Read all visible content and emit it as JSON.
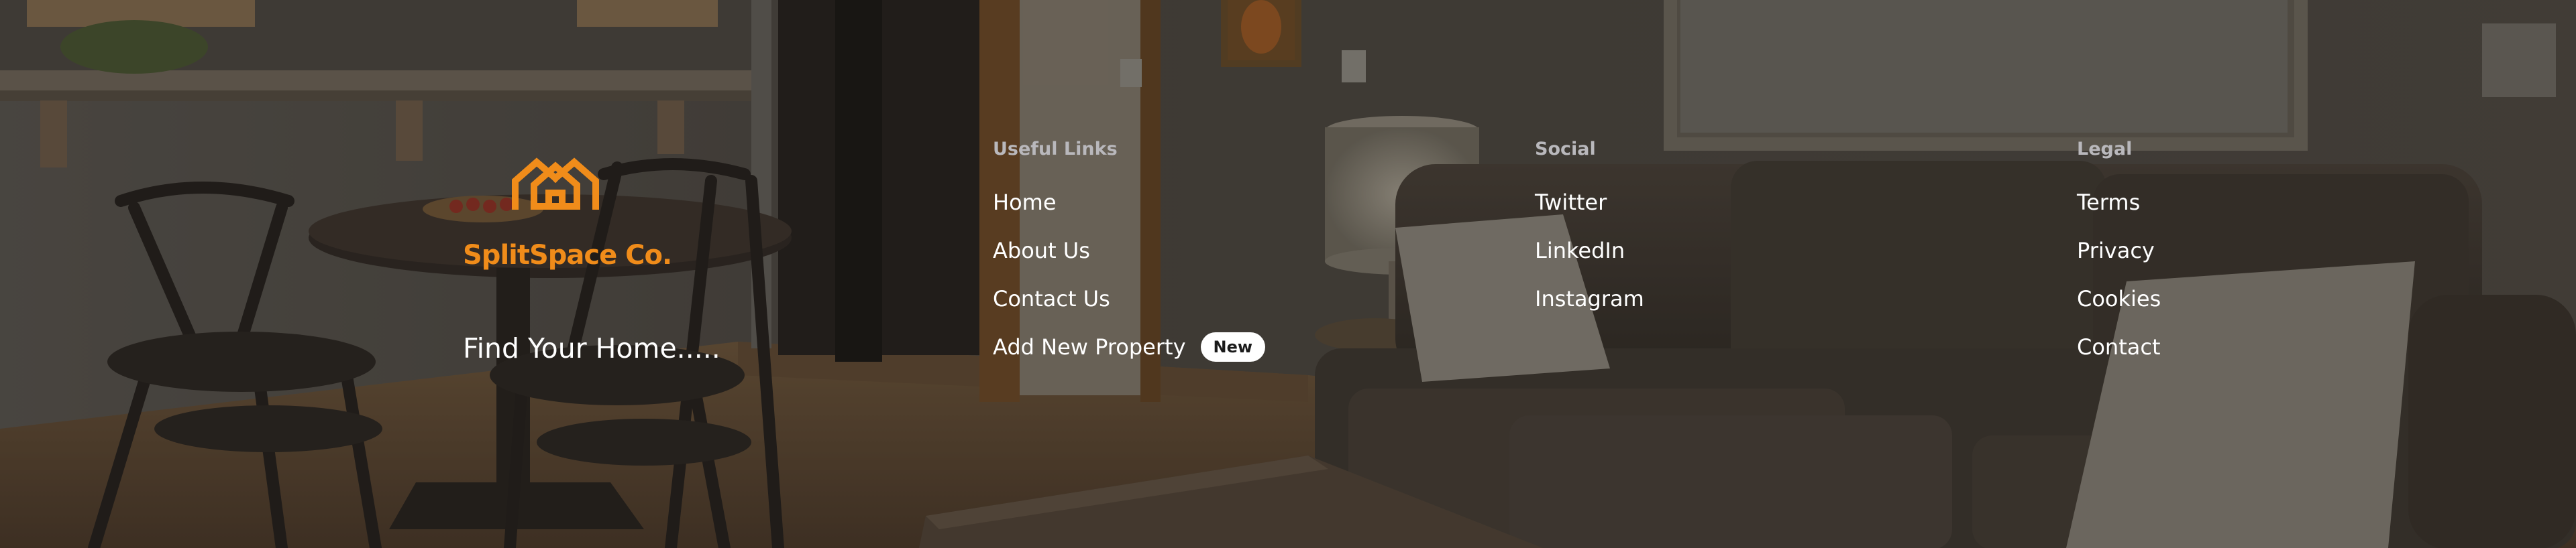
{
  "brand": {
    "name": "SplitSpace Co.",
    "tagline": "Find Your Home.....",
    "accent_color": "#f08c1a",
    "logo_icon": "house-split-logo-icon"
  },
  "columns": [
    {
      "heading": "Useful Links",
      "links": [
        {
          "label": "Home"
        },
        {
          "label": "About Us"
        },
        {
          "label": "Contact Us"
        },
        {
          "label": "Add New Property",
          "badge": "New"
        }
      ]
    },
    {
      "heading": "Social",
      "links": [
        {
          "label": "Twitter"
        },
        {
          "label": "LinkedIn"
        },
        {
          "label": "Instagram"
        }
      ]
    },
    {
      "heading": "Legal",
      "links": [
        {
          "label": "Terms"
        },
        {
          "label": "Privacy"
        },
        {
          "label": "Cookies"
        },
        {
          "label": "Contact"
        }
      ]
    }
  ]
}
